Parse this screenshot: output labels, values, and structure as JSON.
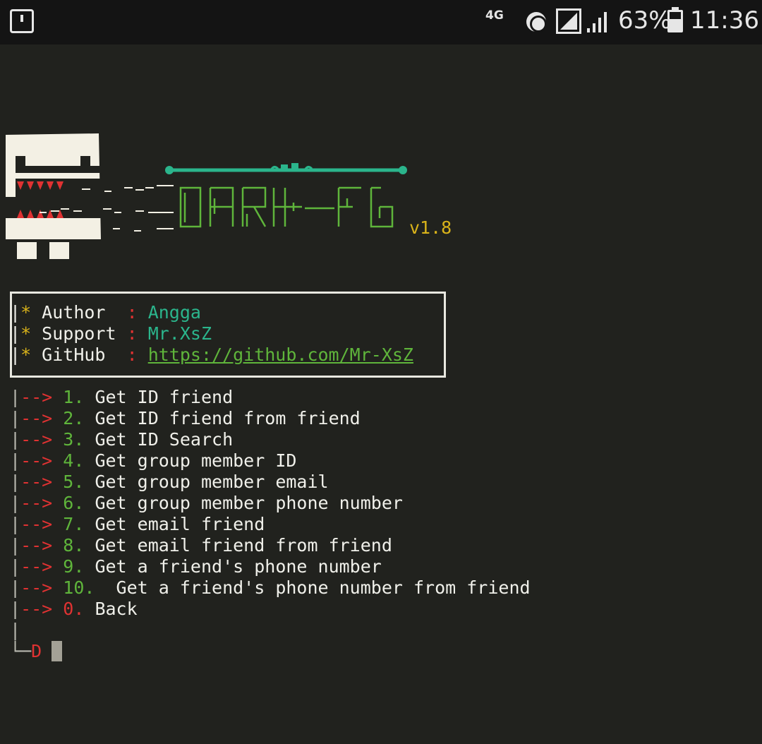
{
  "statusbar": {
    "network": "4G",
    "battery": "63%",
    "time": "11:36"
  },
  "banner": {
    "version": "v1.8"
  },
  "info": [
    {
      "key": "Author ",
      "value": "Angga"
    },
    {
      "key": "Support",
      "value": "Mr.XsZ"
    },
    {
      "key": "GitHub ",
      "value": "https://github.com/Mr-XsZ"
    }
  ],
  "menu": {
    "arrow": "|-->",
    "items": [
      {
        "num": "1.",
        "label": "Get ID friend"
      },
      {
        "num": "2.",
        "label": "Get ID friend from friend"
      },
      {
        "num": "3.",
        "label": "Get ID Search"
      },
      {
        "num": "4.",
        "label": "Get group member ID"
      },
      {
        "num": "5.",
        "label": "Get group member email"
      },
      {
        "num": "6.",
        "label": "Get group member phone number"
      },
      {
        "num": "7.",
        "label": "Get email friend"
      },
      {
        "num": "8.",
        "label": "Get email friend from friend"
      },
      {
        "num": "9.",
        "label": "Get a friend's phone number"
      },
      {
        "num": "10.",
        "label": " Get a friend's phone number from friend"
      },
      {
        "num": "0.",
        "label": "Back"
      }
    ]
  },
  "prompt": {
    "pipe": "|",
    "corner": "└─",
    "char": "D"
  },
  "colors": {
    "background": "#21221e",
    "red": "#e03232",
    "yellow": "#d9b31a",
    "teal": "#2bb58c",
    "green": "#5fb53b"
  }
}
